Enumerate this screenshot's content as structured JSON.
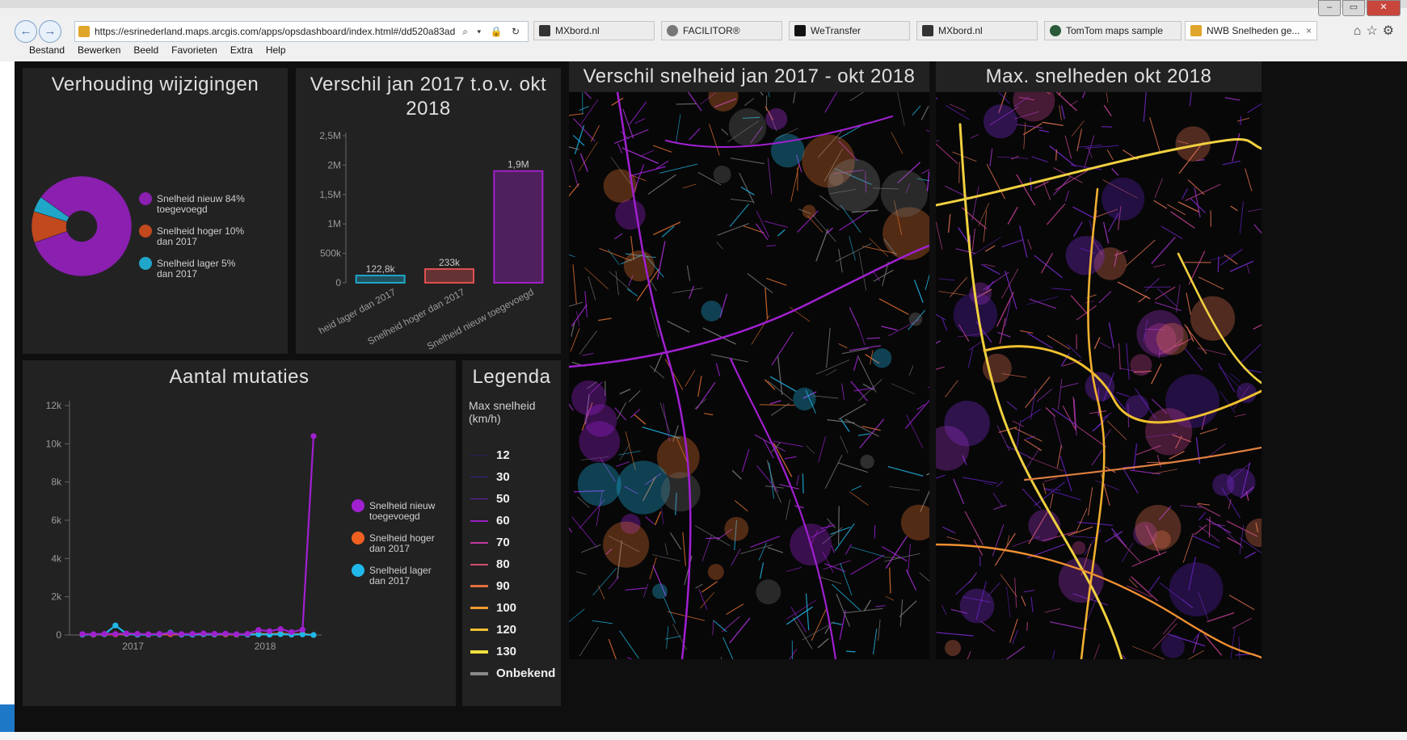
{
  "browser": {
    "url": "https://esrinederland.maps.arcgis.com/apps/opsdashboard/index.html#/dd520a83ad",
    "address_controls": "⌕ ▾ 🔒 ↻",
    "tabs": [
      {
        "label": "MXbord.nl"
      },
      {
        "label": "FACILITOR®"
      },
      {
        "label": "WeTransfer"
      },
      {
        "label": "MXbord.nl"
      },
      {
        "label": "TomTom maps sample"
      },
      {
        "label": "NWB Snelheden ge...",
        "close": "×"
      }
    ],
    "menu": [
      "Bestand",
      "Bewerken",
      "Beeld",
      "Favorieten",
      "Extra",
      "Help"
    ],
    "nav": {
      "back": "←",
      "forward": "→"
    },
    "window_buttons": {
      "minimize": "–",
      "maximize": "▭",
      "close": "✕"
    },
    "toolbar_icons": {
      "home": "⌂",
      "star": "☆",
      "gear": "⚙"
    }
  },
  "panels": {
    "verhouding": {
      "title": "Verhouding wijzigingen"
    },
    "verschil": {
      "title": "Verschil  jan 2017 t.o.v. okt 2018"
    },
    "aantal": {
      "title": "Aantal mutaties"
    },
    "legenda": {
      "title": "Legenda",
      "subtitle": "Max snelheid (km/h)",
      "items": [
        {
          "label": "12",
          "color": "#2a1f5c"
        },
        {
          "label": "30",
          "color": "#3b1f8c"
        },
        {
          "label": "50",
          "color": "#6a1fb0"
        },
        {
          "label": "60",
          "color": "#9a20c0"
        },
        {
          "label": "70",
          "color": "#c03aa0"
        },
        {
          "label": "80",
          "color": "#d0506a"
        },
        {
          "label": "90",
          "color": "#e0703a"
        },
        {
          "label": "100",
          "color": "#f09a30"
        },
        {
          "label": "120",
          "color": "#f0c030"
        },
        {
          "label": "130",
          "color": "#f0e040"
        },
        {
          "label": "Onbekend",
          "color": "#8a8a8a"
        }
      ]
    },
    "map1": {
      "title": "Verschil snelheid jan 2017 - okt 2018"
    },
    "map2": {
      "title": "Max. snelheden okt 2018"
    }
  },
  "chart_data": [
    {
      "type": "pie",
      "title": "Verhouding wijzigingen",
      "slices": [
        {
          "label": "Snelheid nieuw toegevoegd",
          "percent_label": "84%",
          "value": 84,
          "color": "#8a1fb0"
        },
        {
          "label": "Snelheid hoger dan 2017",
          "percent_label": "10%",
          "value": 10,
          "color": "#c2481e"
        },
        {
          "label": "Snelheid lager dan 2017",
          "percent_label": "5%",
          "value": 5,
          "color": "#1fa6c8"
        }
      ]
    },
    {
      "type": "bar",
      "title": "Verschil  jan 2017 t.o.v. okt 2018",
      "categories": [
        "Snelheid lager dan 2017",
        "Snelheid hoger dan 2017",
        "Snelheid nieuw toegevoegd"
      ],
      "values": [
        122800,
        233000,
        1900000
      ],
      "data_labels": [
        "122,8k",
        "233k",
        "1,9M"
      ],
      "colors": [
        "#1fa6c8",
        "#e05050",
        "#a020c8"
      ],
      "ylim": [
        0,
        2500000
      ],
      "yticks": [
        0,
        500000,
        1000000,
        1500000,
        2000000,
        2500000
      ],
      "ytick_labels": [
        "0",
        "500k",
        "1M",
        "1,5M",
        "2M",
        "2,5M"
      ],
      "xtick_labels": [
        "heid lager dan 2017",
        "Snelheid hoger dan 2017",
        "Snelheid nieuw toegevoegd"
      ]
    },
    {
      "type": "line",
      "title": "Aantal mutaties",
      "ylim": [
        0,
        12000
      ],
      "yticks": [
        0,
        2000,
        4000,
        6000,
        8000,
        10000,
        12000
      ],
      "ytick_labels": [
        "0",
        "2k",
        "4k",
        "6k",
        "8k",
        "10k",
        "12k"
      ],
      "xtick_labels": [
        "2017",
        "2018"
      ],
      "x": [
        0,
        1,
        2,
        3,
        4,
        5,
        6,
        7,
        8,
        9,
        10,
        11,
        12,
        13,
        14,
        15,
        16,
        17,
        18,
        19,
        20,
        21
      ],
      "series": [
        {
          "name": "Snelheid nieuw toegevoegd",
          "color": "#a020d0",
          "values": [
            50,
            40,
            60,
            50,
            80,
            60,
            40,
            60,
            90,
            50,
            60,
            80,
            60,
            70,
            40,
            60,
            260,
            200,
            310,
            150,
            280,
            10400
          ]
        },
        {
          "name": "Snelheid hoger dan 2017",
          "color": "#f06020",
          "values": [
            30,
            20,
            40,
            30,
            50,
            30,
            20,
            30,
            40,
            30,
            30,
            40,
            30,
            30,
            20,
            30,
            60,
            50,
            80,
            40,
            60,
            0
          ]
        },
        {
          "name": "Snelheid lager dan 2017",
          "color": "#20b8e8",
          "values": [
            20,
            30,
            40,
            500,
            60,
            20,
            20,
            30,
            120,
            20,
            20,
            40,
            30,
            60,
            30,
            20,
            30,
            20,
            40,
            20,
            30,
            0
          ]
        }
      ],
      "legend": [
        {
          "label": "Snelheid nieuw toegevoegd",
          "color": "#a020d0"
        },
        {
          "label": "Snelheid hoger dan 2017",
          "color": "#f06020"
        },
        {
          "label": "Snelheid lager dan 2017",
          "color": "#20b8e8"
        }
      ]
    }
  ]
}
